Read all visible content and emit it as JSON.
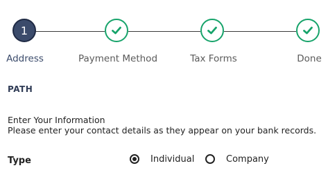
{
  "stepper": {
    "steps": [
      {
        "label": "Address",
        "status": "active",
        "number": "1"
      },
      {
        "label": "Payment Method",
        "status": "complete",
        "icon": "check-icon"
      },
      {
        "label": "Tax Forms",
        "status": "complete",
        "icon": "check-icon"
      },
      {
        "label": "Done",
        "status": "complete",
        "icon": "check-icon"
      }
    ]
  },
  "section": {
    "title": "PATH"
  },
  "form": {
    "heading": "Enter Your Information",
    "subheading": "Please enter your contact details as they appear on your bank records.",
    "type": {
      "label": "Type",
      "options": [
        {
          "label": "Individual",
          "selected": true
        },
        {
          "label": "Company",
          "selected": false
        }
      ]
    }
  },
  "colors": {
    "active_step": "#3b4b6b",
    "complete_step": "#16a36a",
    "connector": "#3a3a3a",
    "section_title": "#2f3b55"
  }
}
